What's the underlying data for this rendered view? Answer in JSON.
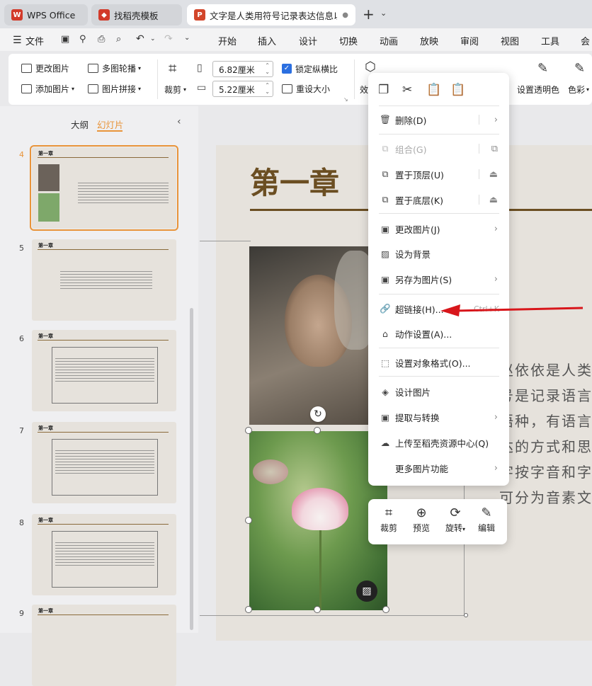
{
  "tabs": [
    {
      "label": "WPS Office"
    },
    {
      "label": "找稻壳模板"
    },
    {
      "label": "文字是人类用符号记录表达信息以"
    }
  ],
  "menu": {
    "file": "文件",
    "items": [
      "开始",
      "插入",
      "设计",
      "切换",
      "动画",
      "放映",
      "审阅",
      "视图",
      "工具",
      "会"
    ]
  },
  "ribbon": {
    "change_image": "更改图片",
    "multi_carousel": "多图轮播",
    "add_image": "添加图片",
    "image_stitch": "图片拼接",
    "crop": "裁剪",
    "width": "6.82厘米",
    "height": "5.22厘米",
    "lock_ratio": "锁定纵横比",
    "reset_size": "重设大小",
    "effects": "效",
    "transparency": "设置透明色",
    "color": "色彩"
  },
  "sidebar": {
    "outline_tab": "大纲",
    "slides_tab": "幻灯片",
    "slide_title": "第一章",
    "slides": [
      {
        "num": "4"
      },
      {
        "num": "5"
      },
      {
        "num": "6"
      },
      {
        "num": "7"
      },
      {
        "num": "8"
      },
      {
        "num": "9"
      }
    ]
  },
  "slide": {
    "title": "第一章",
    "body_lines": [
      "赵依依是人类",
      "号是记录语言",
      "语种，有语言",
      "达的方式和思",
      "字按字音和字",
      "可分为音素文"
    ]
  },
  "context_menu": {
    "items": [
      {
        "label": "删除(D)"
      },
      {
        "label": "组合(G)"
      },
      {
        "label": "置于顶层(U)"
      },
      {
        "label": "置于底层(K)"
      },
      {
        "label": "更改图片(J)"
      },
      {
        "label": "设为背景"
      },
      {
        "label": "另存为图片(S)"
      },
      {
        "label": "超链接(H)...",
        "shortcut": "Ctrl+K"
      },
      {
        "label": "动作设置(A)..."
      },
      {
        "label": "设置对象格式(O)..."
      },
      {
        "label": "设计图片"
      },
      {
        "label": "提取与转换"
      },
      {
        "label": "上传至稻壳资源中心(Q)"
      },
      {
        "label": "更多图片功能"
      }
    ]
  },
  "mini_toolbar": {
    "crop": "裁剪",
    "preview": "预览",
    "rotate": "旋转",
    "edit": "编辑"
  },
  "colors": {
    "accent": "#e8943a",
    "wps_red": "#d23a2a",
    "brand_brown": "#6b4e22",
    "arrow_red": "#d8161b"
  }
}
